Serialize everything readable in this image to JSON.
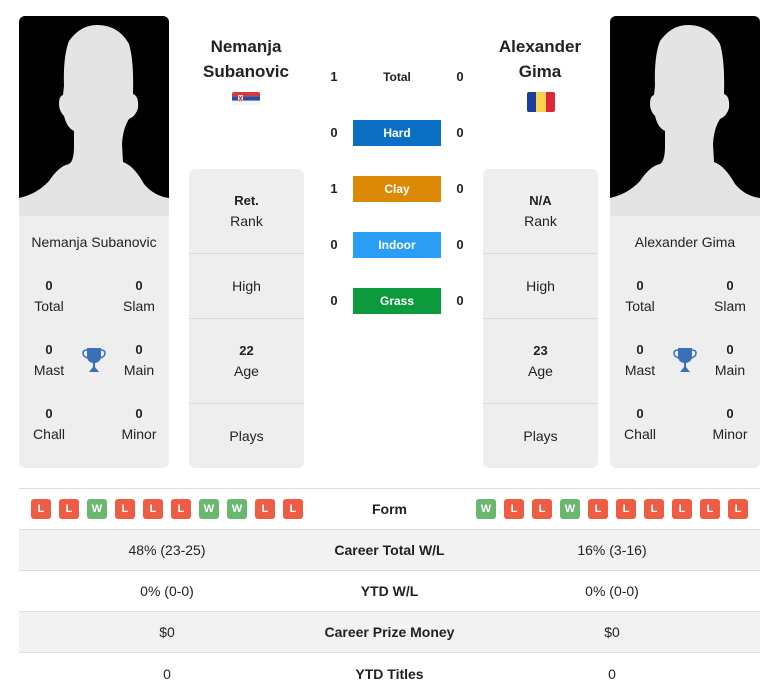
{
  "colors": {
    "hard": "#0a6fc2",
    "clay": "#dc8a06",
    "indoor": "#2a9df4",
    "grass": "#0d9a3c",
    "loss": "#ee5c44",
    "win": "#6ab870",
    "trophy": "#3a6fba"
  },
  "players": {
    "left": {
      "name": "Nemanja Subanovic",
      "name_line1": "Nemanja",
      "name_line2": "Subanovic",
      "flag": "serbia-flag",
      "stats": {
        "total": {
          "value": "0",
          "label": "Total"
        },
        "slam": {
          "value": "0",
          "label": "Slam"
        },
        "mast": {
          "value": "0",
          "label": "Mast"
        },
        "main": {
          "value": "0",
          "label": "Main"
        },
        "chall": {
          "value": "0",
          "label": "Chall"
        },
        "minor": {
          "value": "0",
          "label": "Minor"
        }
      },
      "info": {
        "rank_value": "Ret.",
        "rank_label": "Rank",
        "high_label": "High",
        "age_value": "22",
        "age_label": "Age",
        "plays_label": "Plays"
      },
      "form": [
        "L",
        "L",
        "W",
        "L",
        "L",
        "L",
        "W",
        "W",
        "L",
        "L"
      ],
      "career_wl": "48% (23-25)",
      "ytd_wl": "0% (0-0)",
      "prize": "$0",
      "ytd_titles": "0"
    },
    "right": {
      "name": "Alexander Gima",
      "name_line1": "Alexander",
      "name_line2": "Gima",
      "flag": "romania-flag",
      "stats": {
        "total": {
          "value": "0",
          "label": "Total"
        },
        "slam": {
          "value": "0",
          "label": "Slam"
        },
        "mast": {
          "value": "0",
          "label": "Mast"
        },
        "main": {
          "value": "0",
          "label": "Main"
        },
        "chall": {
          "value": "0",
          "label": "Chall"
        },
        "minor": {
          "value": "0",
          "label": "Minor"
        }
      },
      "info": {
        "rank_value": "N/A",
        "rank_label": "Rank",
        "high_label": "High",
        "age_value": "23",
        "age_label": "Age",
        "plays_label": "Plays"
      },
      "form": [
        "W",
        "L",
        "L",
        "W",
        "L",
        "L",
        "L",
        "L",
        "L",
        "L"
      ],
      "career_wl": "16% (3-16)",
      "ytd_wl": "0% (0-0)",
      "prize": "$0",
      "ytd_titles": "0"
    }
  },
  "h2h": [
    {
      "surface": "Total",
      "left": "1",
      "right": "0"
    },
    {
      "surface": "Hard",
      "left": "0",
      "right": "0"
    },
    {
      "surface": "Clay",
      "left": "1",
      "right": "0"
    },
    {
      "surface": "Indoor",
      "left": "0",
      "right": "0"
    },
    {
      "surface": "Grass",
      "left": "0",
      "right": "0"
    }
  ],
  "table_labels": {
    "form": "Form",
    "career_wl": "Career Total W/L",
    "ytd_wl": "YTD W/L",
    "prize": "Career Prize Money",
    "ytd_titles": "YTD Titles"
  }
}
